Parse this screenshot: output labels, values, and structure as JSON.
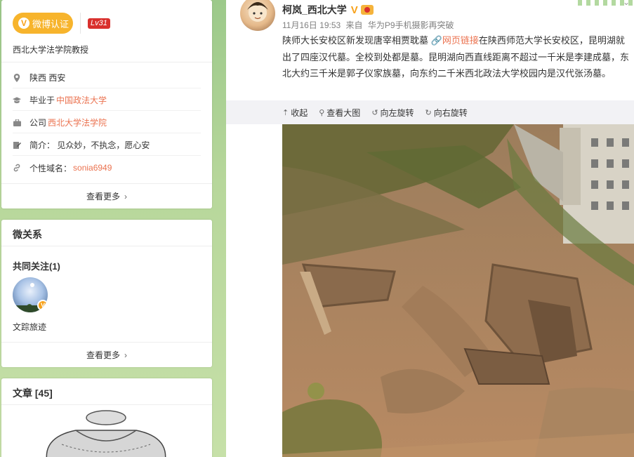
{
  "profile": {
    "verified_label": "微博认证",
    "level": "Lv31",
    "description": "西北大学法学院教授",
    "info": [
      {
        "icon": "location-icon",
        "text": "陕西 西安",
        "link": ""
      },
      {
        "icon": "graduation-cap-icon",
        "text": "毕业于",
        "link": "中国政法大学"
      },
      {
        "icon": "briefcase-icon",
        "text": "公司",
        "link": "西北大学法学院"
      },
      {
        "icon": "edit-icon",
        "text": "简介：  见众妙，不执念，愿心安",
        "link": ""
      },
      {
        "icon": "link-icon",
        "text": "个性域名：",
        "link": "sonia6949"
      }
    ],
    "more": "查看更多"
  },
  "relation": {
    "title": "微关系",
    "mutual_title": "共同关注(1)",
    "mutual_name": "文踪旅迹",
    "more": "查看更多"
  },
  "article": {
    "title": "文章 [45]"
  },
  "post": {
    "username": "柯岚_西北大学",
    "verified_mark": "V",
    "meta_time": "11月16日 19:53",
    "meta_from": "来自",
    "meta_source": "华为P9手机摄影再突破",
    "text_part1": "陕师大长安校区新发现唐宰相贾耽墓",
    "weblink": "网页链接",
    "text_part2": "在陕西师范大学长安校区，昆明湖就出了四座汉代墓。全校到处都是墓。昆明湖向西直线距离不超过一千米是李建成墓，东北大约三千米是郭子仪家族墓，向东约二千米西北政法大学校园内是汉代张汤墓。",
    "tools": [
      {
        "icon": "collapse-icon",
        "glyph": "⇡",
        "label": "收起"
      },
      {
        "icon": "zoom-icon",
        "glyph": "⚲",
        "label": "查看大图"
      },
      {
        "icon": "rotate-left-icon",
        "glyph": "↺",
        "label": "向左旋转"
      },
      {
        "icon": "rotate-right-icon",
        "glyph": "↻",
        "label": "向右旋转"
      }
    ]
  },
  "colors": {
    "accent_orange": "#eb7350",
    "verified_gold": "#f7b42c",
    "level_red": "#d9302d"
  }
}
